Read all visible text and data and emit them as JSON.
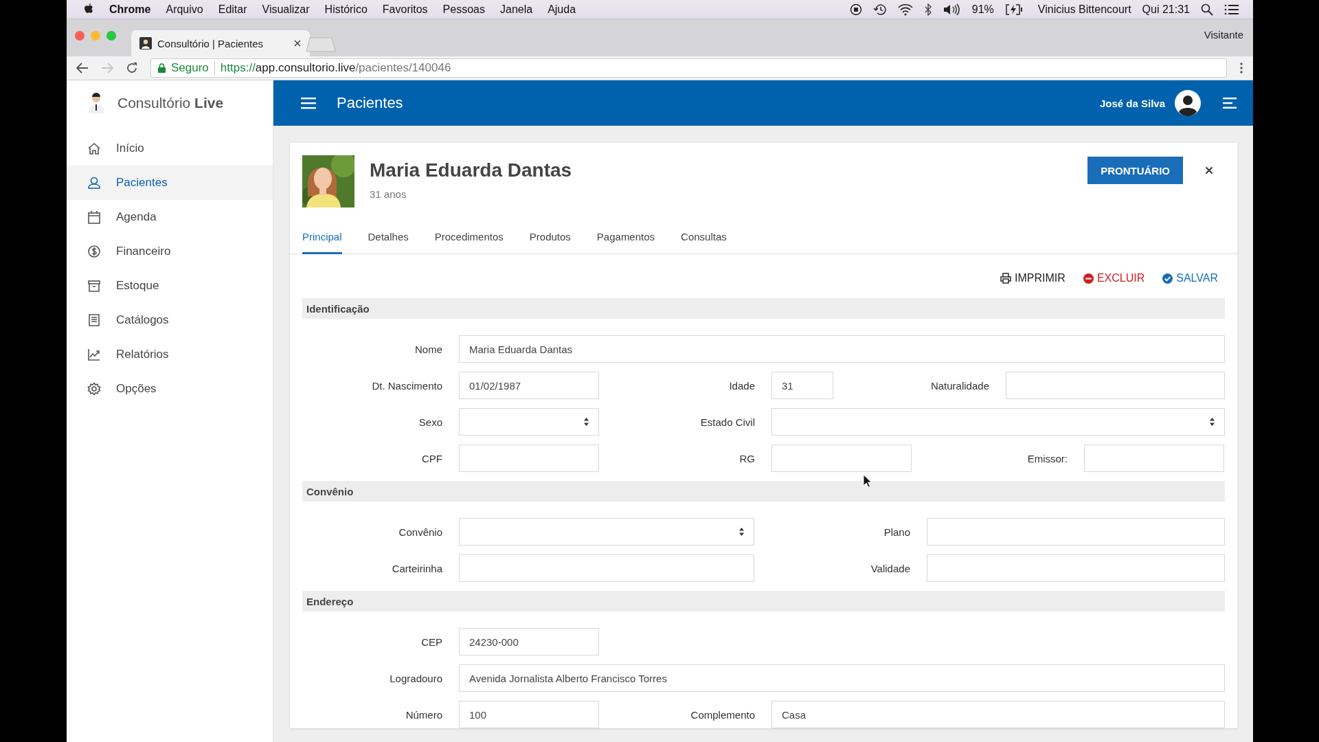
{
  "menu_bar": {
    "app": "Chrome",
    "menus": [
      "Arquivo",
      "Editar",
      "Visualizar",
      "Histórico",
      "Favoritos",
      "Pessoas",
      "Janela",
      "Ajuda"
    ],
    "battery": "91%",
    "user": "Vinicius Bittencourt",
    "clock": "Qui 21:31"
  },
  "browser": {
    "tab_title": "Consultório | Pacientes",
    "profile": "Visitante",
    "security": "Seguro",
    "url": {
      "scheme": "https://",
      "host": "app.consultorio.live",
      "path": "/pacientes/140046"
    }
  },
  "sidebar": {
    "brand": "Consultório **Live**",
    "items": [
      {
        "label": "Início",
        "selected": false
      },
      {
        "label": "Pacientes",
        "selected": true
      },
      {
        "label": "Agenda",
        "selected": false
      },
      {
        "label": "Financeiro",
        "selected": false
      },
      {
        "label": "Estoque",
        "selected": false
      },
      {
        "label": "Catálogos",
        "selected": false
      },
      {
        "label": "Relatórios",
        "selected": false
      },
      {
        "label": "Opções",
        "selected": false
      }
    ]
  },
  "header": {
    "title": "Pacientes",
    "user": "José da Silva"
  },
  "patient": {
    "name": "Maria Eduarda Dantas",
    "age": "31 anos",
    "record_button": "PRONTUÁRIO"
  },
  "tabs": [
    {
      "label": "Principal",
      "selected": true
    },
    {
      "label": "Detalhes",
      "selected": false
    },
    {
      "label": "Procedimentos",
      "selected": false
    },
    {
      "label": "Produtos",
      "selected": false
    },
    {
      "label": "Pagamentos",
      "selected": false
    },
    {
      "label": "Consultas",
      "selected": false
    }
  ],
  "actions": [
    {
      "kind": "print",
      "label": "IMPRIMIR"
    },
    {
      "kind": "delete",
      "label": "EXCLUIR"
    },
    {
      "kind": "save",
      "label": "SALVAR"
    }
  ],
  "sections": [
    {
      "title": "Identificação",
      "rows": [
        [
          {
            "label": "Nome",
            "kind": "text",
            "value": "Maria Eduarda Dantas"
          }
        ],
        [
          {
            "label": "Dt. Nascimento",
            "kind": "text",
            "value": "01/02/1987"
          },
          {
            "label": "Idade",
            "kind": "text",
            "value": "31"
          },
          {
            "label": "Naturalidade",
            "kind": "text"
          }
        ],
        [
          {
            "label": "Sexo",
            "kind": "select"
          },
          {
            "label": "Estado Civil",
            "kind": "select"
          }
        ],
        [
          {
            "label": "CPF",
            "kind": "text"
          },
          {
            "label": "RG",
            "kind": "text"
          },
          {
            "label": "Emissor:",
            "kind": "text"
          }
        ]
      ]
    },
    {
      "title": "Convênio",
      "rows": [
        [
          {
            "label": "Convênio",
            "kind": "select"
          },
          {
            "label": "Plano",
            "kind": "text"
          }
        ],
        [
          {
            "label": "Carteirinha",
            "kind": "text"
          },
          {
            "label": "Validade",
            "kind": "text"
          }
        ]
      ]
    },
    {
      "title": "Endereço",
      "rows": [
        [
          {
            "label": "CEP",
            "kind": "text",
            "value": "24230-000"
          }
        ],
        [
          {
            "label": "Logradouro",
            "kind": "text",
            "value": "Avenida Jornalista Alberto Francisco Torres"
          }
        ],
        [
          {
            "label": "Número",
            "kind": "text",
            "value": "100"
          },
          {
            "label": "Complemento",
            "kind": "text",
            "value": "Casa"
          }
        ]
      ]
    }
  ]
}
